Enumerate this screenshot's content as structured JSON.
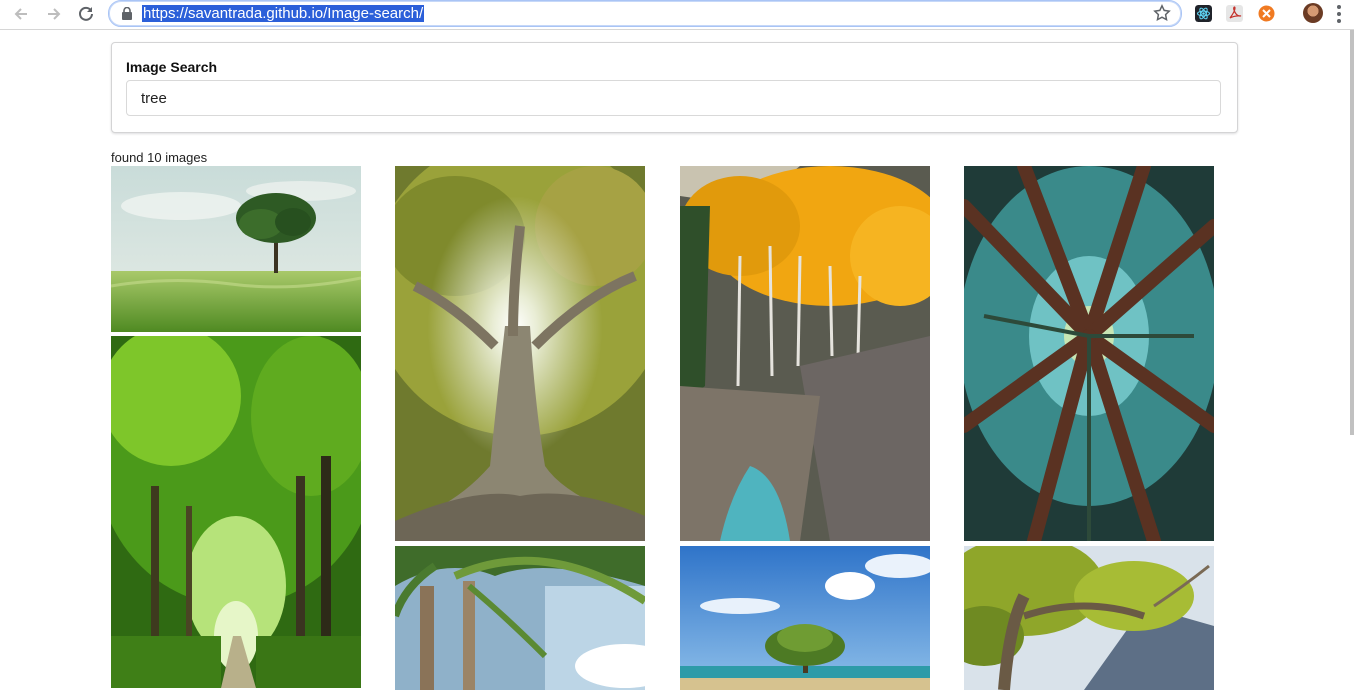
{
  "browser": {
    "url": "https://savantrada.github.io/Image-search/"
  },
  "search": {
    "label": "Image Search",
    "value": "tree"
  },
  "results": {
    "count_text": "found 10 images",
    "images": [
      {
        "subject": "lone tree in green field"
      },
      {
        "subject": "green tree tunnel road"
      },
      {
        "subject": "giant ficus tree with sunburst"
      },
      {
        "subject": "palm trees"
      },
      {
        "subject": "golden aspen trees over mountain stream"
      },
      {
        "subject": "lone tree on beach under blue sky"
      },
      {
        "subject": "looking up redwood forest canopy"
      },
      {
        "subject": "leafy tree against mountain"
      }
    ]
  },
  "colors": {
    "url_highlight": "#2b5fd9",
    "omnibox_border": "#a9c4f5"
  }
}
